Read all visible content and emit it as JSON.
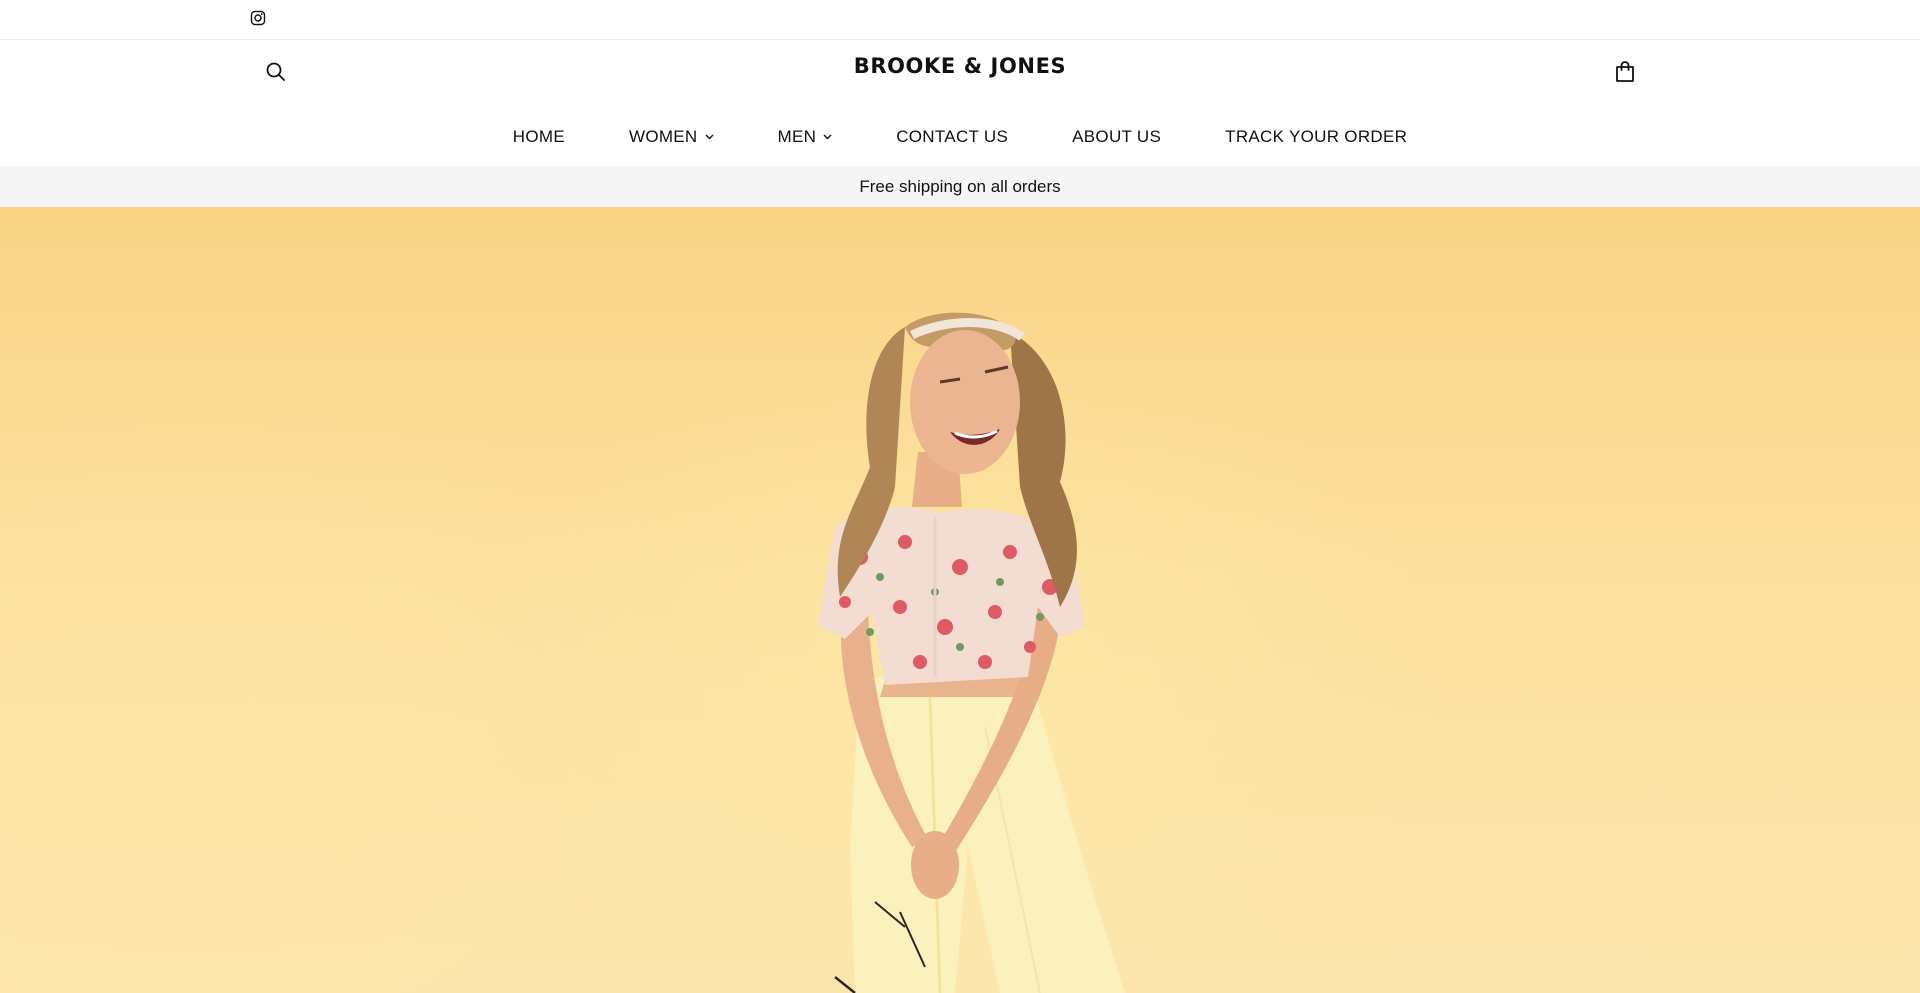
{
  "topbar": {
    "social_icon": "instagram-icon"
  },
  "header": {
    "logo": "BROOKE & JONES",
    "search_icon": "search-icon",
    "cart_icon": "shopping-bag-icon"
  },
  "nav": {
    "items": [
      {
        "label": "HOME",
        "has_dropdown": false
      },
      {
        "label": "WOMEN",
        "has_dropdown": true
      },
      {
        "label": "MEN",
        "has_dropdown": true
      },
      {
        "label": "CONTACT US",
        "has_dropdown": false
      },
      {
        "label": "ABOUT US",
        "has_dropdown": false
      },
      {
        "label": "TRACK YOUR ORDER",
        "has_dropdown": false
      }
    ]
  },
  "announcement": {
    "text": "Free shipping on all orders"
  },
  "hero": {
    "image_subject": "woman-in-floral-top-and-yellow-trousers",
    "background_color": "#fcdf9c"
  },
  "colors": {
    "text": "#111111",
    "announcement_bg": "#f5f5f5",
    "border": "#ececec"
  }
}
